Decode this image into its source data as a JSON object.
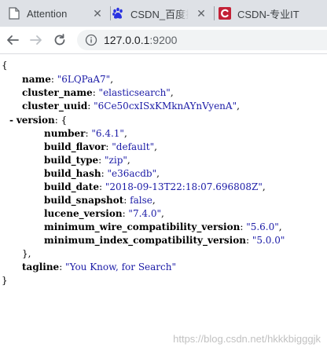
{
  "tabs": [
    {
      "title": "Attention",
      "icon": "document-icon",
      "active": false
    },
    {
      "title": "CSDN_百度搜",
      "icon": "baidu-paw-icon",
      "active": false
    },
    {
      "title": "CSDN-专业IT",
      "icon": "csdn-c-icon",
      "active": true
    }
  ],
  "address_bar": {
    "host": "127.0.0.1",
    "port": ":9200"
  },
  "json": {
    "open_brace": "{",
    "name_key": "name",
    "name_val": "\"6LQPaA7\"",
    "cluster_name_key": "cluster_name",
    "cluster_name_val": "\"elasticsearch\"",
    "cluster_uuid_key": "cluster_uuid",
    "cluster_uuid_val": "\"6Ce50cxISxKMknAYnVyenA\"",
    "version_toggle": "-",
    "version_key": "version",
    "version_open": "{",
    "number_key": "number",
    "number_val": "\"6.4.1\"",
    "build_flavor_key": "build_flavor",
    "build_flavor_val": "\"default\"",
    "build_type_key": "build_type",
    "build_type_val": "\"zip\"",
    "build_hash_key": "build_hash",
    "build_hash_val": "\"e36acdb\"",
    "build_date_key": "build_date",
    "build_date_val": "\"2018-09-13T22:18:07.696808Z\"",
    "build_snapshot_key": "build_snapshot",
    "build_snapshot_val": "false",
    "lucene_version_key": "lucene_version",
    "lucene_version_val": "\"7.4.0\"",
    "min_wire_key": "minimum_wire_compatibility_version",
    "min_wire_val": "\"5.6.0\"",
    "min_index_key": "minimum_index_compatibility_version",
    "min_index_val": "\"5.0.0\"",
    "version_close": "},",
    "tagline_key": "tagline",
    "tagline_val": "\"You Know, for Search\"",
    "close_brace": "}"
  },
  "watermark": "https://blog.csdn.net/hkkkbigggjk",
  "colors": {
    "tabstrip_bg": "#dee1e6",
    "json_string": "#1a1aa6",
    "csdn_red": "#c32136",
    "baidu_blue": "#2932e1"
  }
}
